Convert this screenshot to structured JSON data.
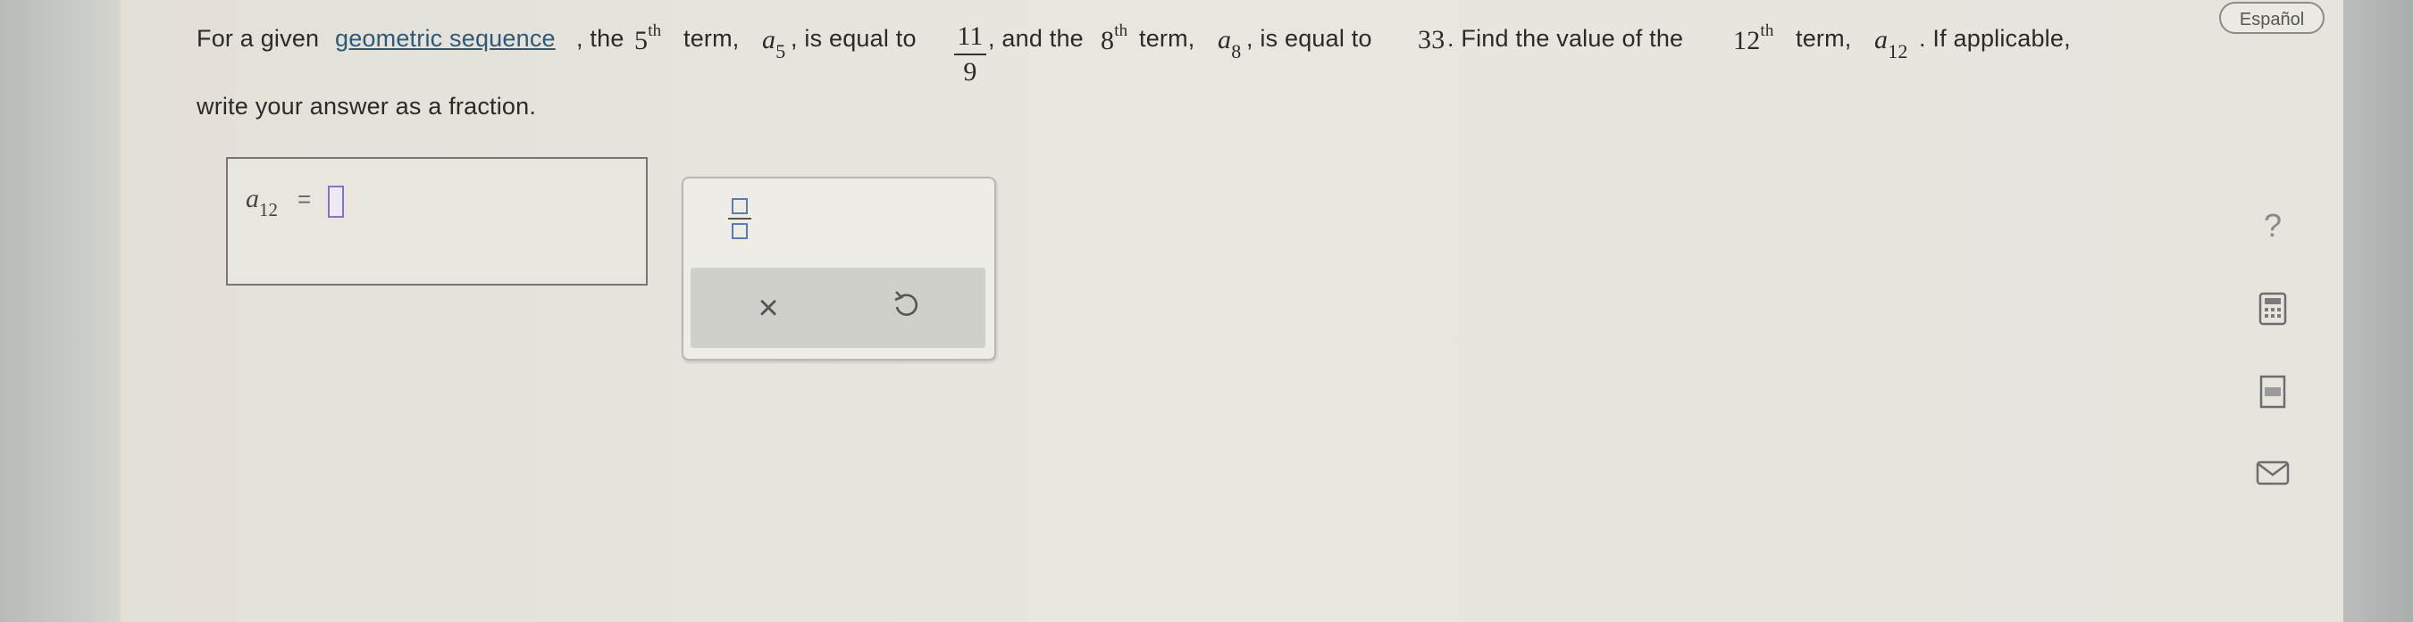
{
  "header": {
    "language_button": "Español"
  },
  "question": {
    "intro": "For a given ",
    "link_text": "geometric sequence",
    "after_link": ", the ",
    "n5": "5",
    "sup_th": "th",
    "term_word": " term, ",
    "a_symbol": "a",
    "sub5": "5",
    "is_equal_to": ", is equal to",
    "frac_num": "11",
    "frac_den": "9",
    "and_the": ", and the ",
    "n8": "8",
    "sub8": "8",
    "is_equal_to_33": ", is equal to ",
    "value33": "33",
    "find_value": ". Find the value of the ",
    "n12": "12",
    "sub12": "12",
    "if_applicable": ". If applicable,",
    "line2": "write your answer as a fraction."
  },
  "answer": {
    "label": "a",
    "label_sub": "12",
    "equals": "=",
    "value": ""
  },
  "palette": {
    "fraction_icon": "fraction-template-icon",
    "clear_icon": "close-icon",
    "undo_icon": "undo-icon",
    "clear_glyph": "×"
  },
  "sidebar": {
    "help_glyph": "?",
    "icons": [
      "help-icon",
      "calculator-icon",
      "reference-icon",
      "mail-icon"
    ]
  },
  "colors": {
    "link": "#2c5a78",
    "input_border": "#8b6fc5",
    "fraction_box": "#5b7bb6"
  }
}
